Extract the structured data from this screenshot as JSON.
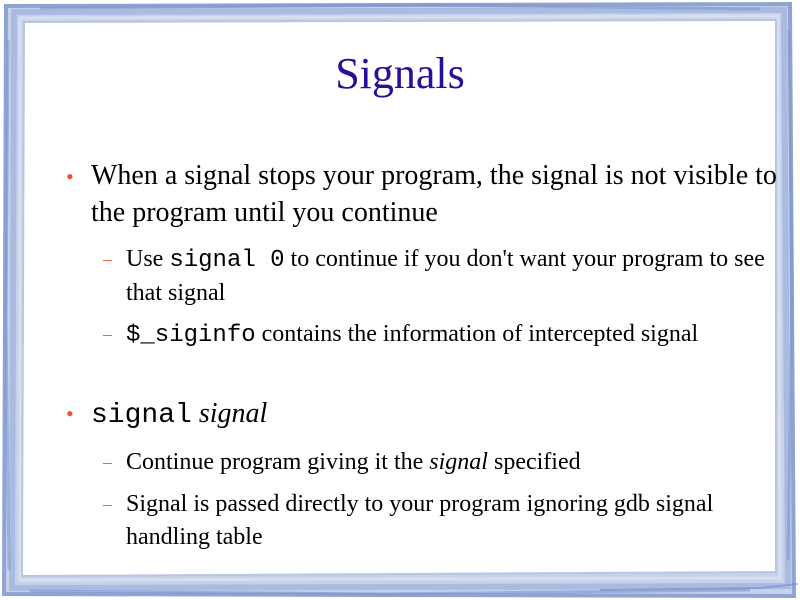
{
  "slide": {
    "title": "Signals",
    "accent_color": "#e8552d",
    "title_color": "#2b0c9c",
    "frame_color": "#9aaed6",
    "bullet_symbol": "•",
    "dash_symbol": "–"
  },
  "bullets": [
    {
      "text": "When a signal stops your program, the signal is not visible to the program until you continue",
      "subitems": [
        {
          "pre": "Use ",
          "code": "signal 0",
          "post": " to continue if you don't want your program to see that signal"
        },
        {
          "code": "$_siginfo",
          "post": " contains the information of intercepted signal"
        }
      ]
    },
    {
      "code": "signal",
      "italic": "signal",
      "subitems": [
        {
          "pre": "Continue program giving it the ",
          "italic": "signal",
          "post": " specified"
        },
        {
          "text": "Signal is passed directly to your program ignoring gdb signal handling table"
        }
      ]
    }
  ]
}
